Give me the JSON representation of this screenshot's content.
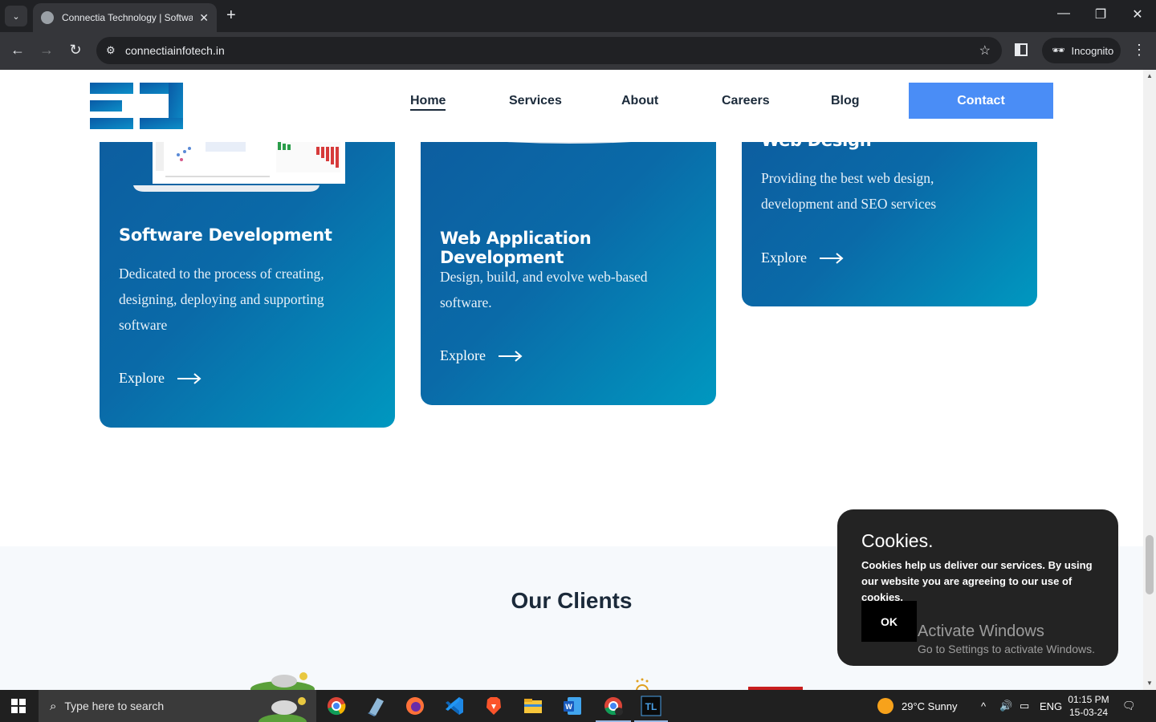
{
  "browser": {
    "tab_title": "Connectia Technology | Software",
    "url": "connectiainfotech.in",
    "incognito_label": "Incognito"
  },
  "nav": {
    "items": [
      "Home",
      "Services",
      "About",
      "Careers",
      "Blog"
    ],
    "contact": "Contact"
  },
  "cards": [
    {
      "title": "Software Development",
      "text": "Dedicated to the process of creating, designing, deploying and supporting software",
      "explore": "Explore"
    },
    {
      "title": "Web Application Development",
      "text": "Design, build, and evolve web-based software.",
      "explore": "Explore"
    },
    {
      "title": "Web Design",
      "text": "Providing the best web design, development and SEO services",
      "explore": "Explore"
    }
  ],
  "clients": {
    "title": "Our Clients"
  },
  "cookie": {
    "title": "Cookies.",
    "text": "Cookies help us deliver our services. By using our website you are agreeing to our use of cookies.",
    "ok": "OK"
  },
  "watermark": {
    "title": "Activate Windows",
    "subtitle": "Go to Settings to activate Windows."
  },
  "taskbar": {
    "search_placeholder": "Type here to search",
    "weather": "29°C  Sunny",
    "lang": "ENG",
    "time": "01:15 PM",
    "date": "15-03-24"
  },
  "colors": {
    "accent": "#4a8df6",
    "card_start": "#0d5ea0",
    "card_end": "#0098c0"
  }
}
